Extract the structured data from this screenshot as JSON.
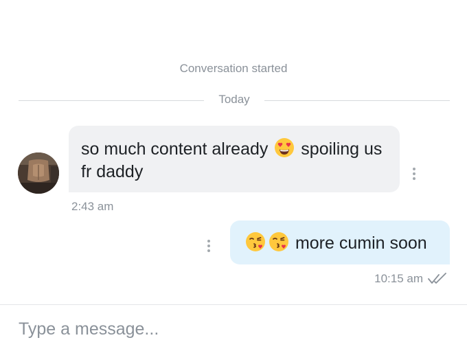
{
  "thread": {
    "conversation_started": "Conversation started",
    "date_divider": "Today"
  },
  "messages": [
    {
      "direction": "incoming",
      "text_before_emoji": "so much content already",
      "emoji": "smiling-face-with-heart-eyes",
      "text_after_emoji": "spoiling us fr daddy",
      "time": "2:43 am"
    },
    {
      "direction": "outgoing",
      "emojis": [
        "face-blowing-a-kiss",
        "face-blowing-a-kiss"
      ],
      "text": "more cumin soon",
      "time": "10:15 am",
      "status_icon": "double-check-read-icon"
    }
  ],
  "composer": {
    "placeholder": "Type a message..."
  },
  "colors": {
    "incoming_bubble": "#f0f1f3",
    "outgoing_bubble": "#e1f2fc",
    "muted_text": "#8a9199",
    "emoji_yellow": "#ffc83d",
    "heart_red": "#e8334a"
  }
}
